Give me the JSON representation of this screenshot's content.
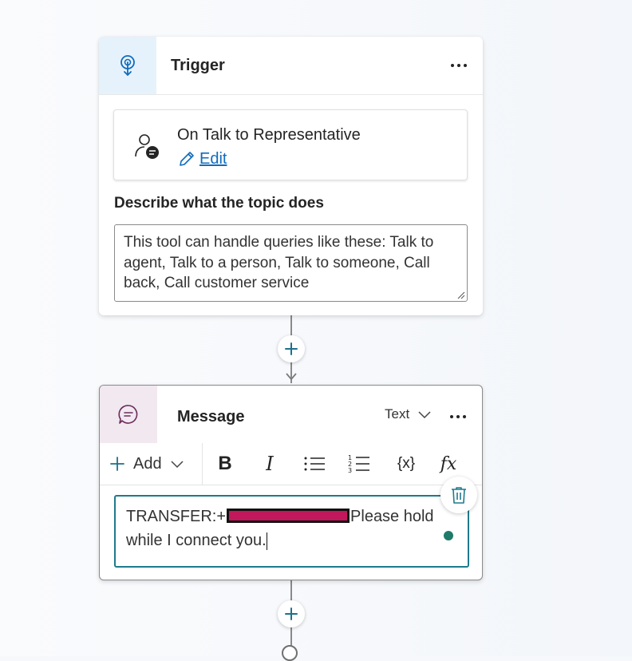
{
  "trigger": {
    "title": "Trigger",
    "topic_name": "On Talk to Representative",
    "edit_label": "Edit",
    "description_label": "Describe what the topic does",
    "description_value": "This tool can handle queries like these: Talk to agent, Talk to a person, Talk to someone, Call back, Call customer service"
  },
  "message": {
    "title": "Message",
    "type_select": "Text",
    "toolbar": {
      "add_label": "Add",
      "bold": "B",
      "italic": "I",
      "variable": "{x}",
      "formula": "fx"
    },
    "text_before_redaction": "TRANSFER:+",
    "text_after_redaction": "Please hold while I connect you."
  },
  "colors": {
    "accent": "#0f6cbd",
    "editor_border": "#1f7a8c",
    "status_dot": "#1f7a6a",
    "redaction": "#c2185b"
  },
  "icons": {
    "trigger_icon": "trigger-pin-icon",
    "topic_icon": "person-chat-icon",
    "message_icon": "chat-bubble-icon"
  }
}
